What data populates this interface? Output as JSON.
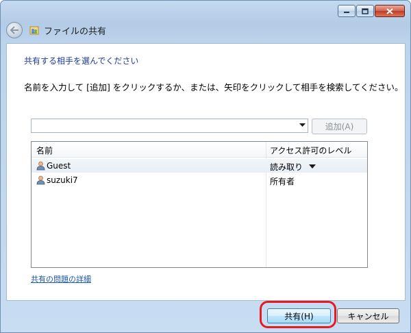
{
  "window": {
    "title": "ファイルの共有",
    "controls": [
      "minimize-icon",
      "maximize-icon",
      "close-icon"
    ]
  },
  "main": {
    "instruction": "共有する相手を選んでください",
    "description": "名前を入力して [追加] をクリックするか、または、矢印をクリックして相手を検索してください。",
    "name_input": {
      "value": "",
      "placeholder": ""
    },
    "add_button_label": "追加(A)",
    "list": {
      "columns": [
        "名前",
        "アクセス許可のレベル"
      ],
      "rows": [
        {
          "name": "Guest",
          "permission": "読み取り"
        },
        {
          "name": "suzuki7",
          "permission": "所有者"
        }
      ]
    },
    "help_link": "共有の問題の詳細"
  },
  "footer": {
    "share_button_label": "共有(H)",
    "cancel_button_label": "キャンセル"
  },
  "colors": {
    "highlight": "#e31b23",
    "instruction_text": "#1e3b9a",
    "link": "#1c56b5"
  }
}
